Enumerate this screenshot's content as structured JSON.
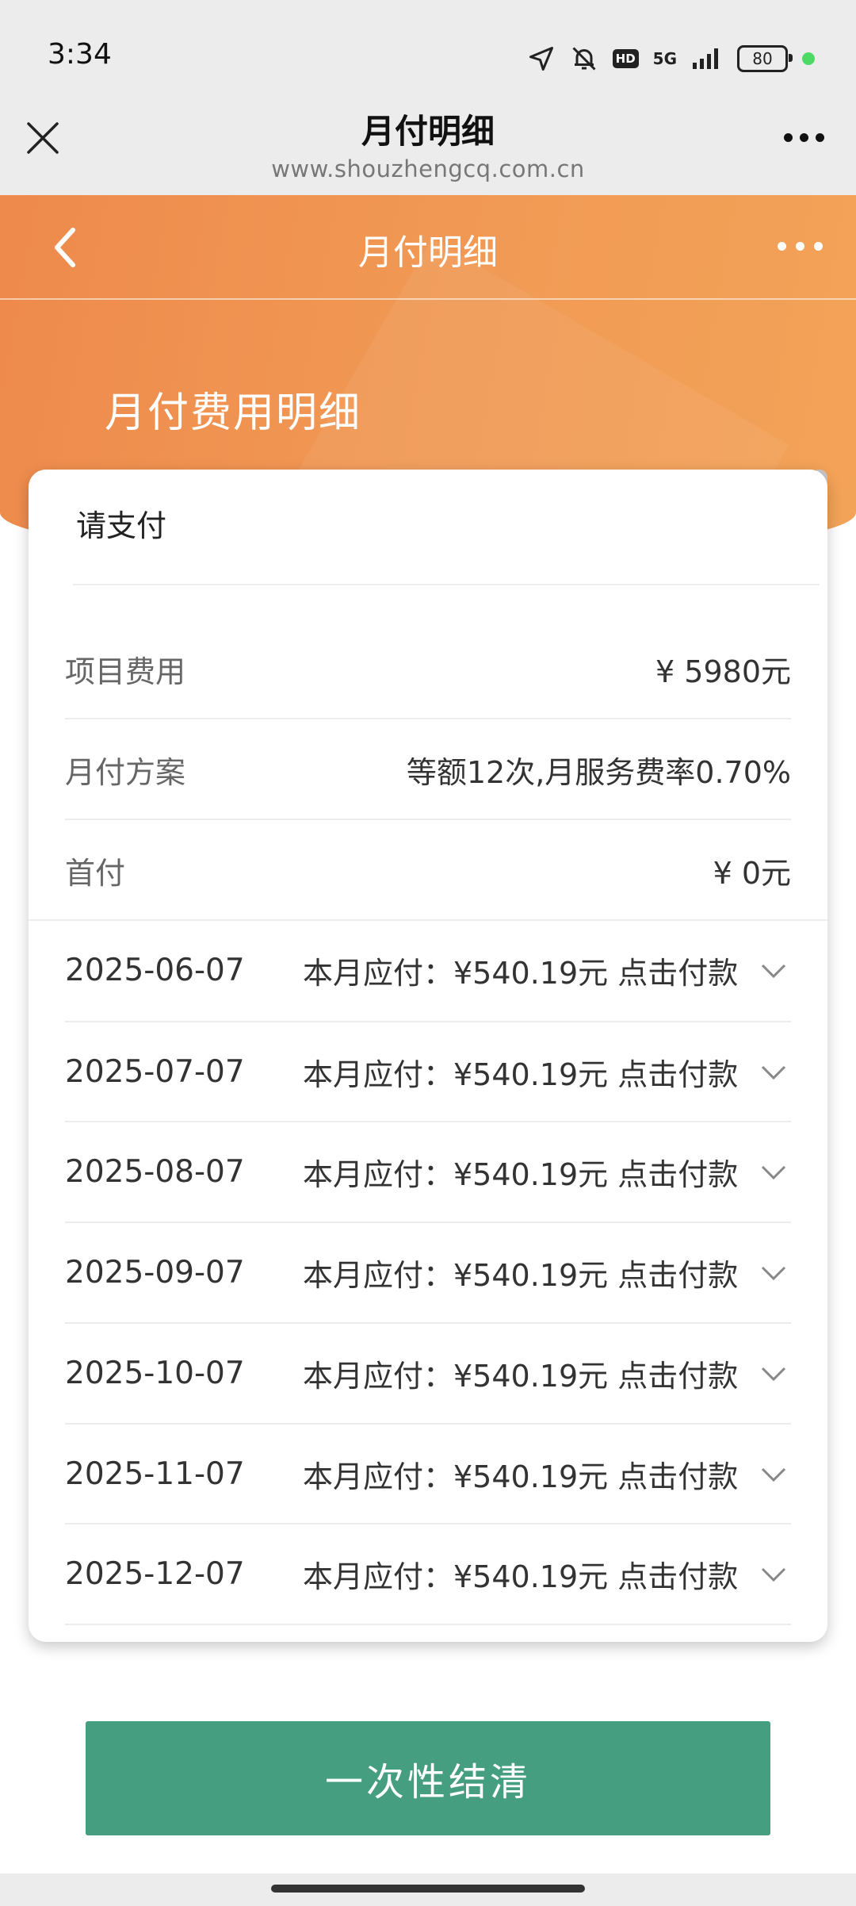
{
  "status_bar": {
    "time": "3:34",
    "network": "5G",
    "hd": "HD",
    "battery": "80"
  },
  "webview": {
    "title": "月付明细",
    "url": "www.shouzhengcq.com.cn"
  },
  "nav": {
    "title": "月付明细"
  },
  "section": {
    "title": "月付费用明细"
  },
  "card": {
    "header": "请支付",
    "info_rows": [
      {
        "label": "项目费用",
        "value": "¥ 5980元"
      },
      {
        "label": "月付方案",
        "value": "等额12次,月服务费率0.70%"
      },
      {
        "label": "首付",
        "value": "¥ 0元"
      }
    ],
    "payments": [
      {
        "date": "2025-06-07",
        "due": "本月应付：¥540.19元 点击付款"
      },
      {
        "date": "2025-07-07",
        "due": "本月应付：¥540.19元 点击付款"
      },
      {
        "date": "2025-08-07",
        "due": "本月应付：¥540.19元 点击付款"
      },
      {
        "date": "2025-09-07",
        "due": "本月应付：¥540.19元 点击付款"
      },
      {
        "date": "2025-10-07",
        "due": "本月应付：¥540.19元 点击付款"
      },
      {
        "date": "2025-11-07",
        "due": "本月应付：¥540.19元 点击付款"
      },
      {
        "date": "2025-12-07",
        "due": "本月应付：¥540.19元 点击付款"
      }
    ]
  },
  "actions": {
    "pay_all_label": "一次性结清"
  },
  "colors": {
    "header_orange": "#f19a55",
    "button_green": "#469e80"
  }
}
